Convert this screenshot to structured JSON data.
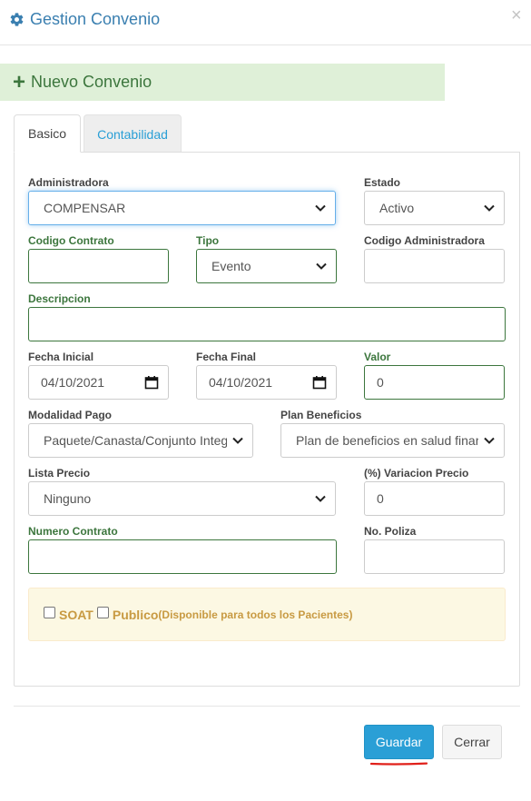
{
  "header": {
    "title": "Gestion Convenio",
    "icon": "gear-icon",
    "close_label": "×",
    "title_color": "#3a7fb0"
  },
  "banner": {
    "label": "Nuevo Convenio",
    "plus": "+",
    "bg_color": "#dff0d8",
    "text_color": "#3c763d"
  },
  "tabs": [
    {
      "label": "Basico",
      "active": true
    },
    {
      "label": "Contabilidad",
      "active": false
    }
  ],
  "form": {
    "administradora": {
      "label": "Administradora",
      "value": "COMPENSAR"
    },
    "estado": {
      "label": "Estado",
      "value": "Activo"
    },
    "codigo_contrato": {
      "label": "Codigo Contrato",
      "value": ""
    },
    "tipo": {
      "label": "Tipo",
      "value": "Evento"
    },
    "codigo_administradora": {
      "label": "Codigo Administradora",
      "value": ""
    },
    "descripcion": {
      "label": "Descripcion",
      "value": ""
    },
    "fecha_inicial": {
      "label": "Fecha Inicial",
      "value": "04/10/2021"
    },
    "fecha_final": {
      "label": "Fecha Final",
      "value": "04/10/2021"
    },
    "valor": {
      "label": "Valor",
      "value": "0"
    },
    "modalidad_pago": {
      "label": "Modalidad Pago",
      "value": "Paquete/Canasta/Conjunto Integ"
    },
    "plan_beneficios": {
      "label": "Plan Beneficios",
      "value": "Plan de beneficios en salud finar"
    },
    "lista_precio": {
      "label": "Lista Precio",
      "value": "Ninguno"
    },
    "variacion_precio": {
      "label": "(%) Variacion Precio",
      "value": "0"
    },
    "numero_contrato": {
      "label": "Numero Contrato",
      "value": ""
    },
    "no_poliza": {
      "label": "No. Poliza",
      "value": ""
    }
  },
  "options": {
    "soat_label": "SOAT",
    "publico_label": "Publico",
    "publico_note": "(Disponible para todos los Pacientes)",
    "soat_checked": false,
    "publico_checked": false
  },
  "footer": {
    "save_label": "Guardar",
    "close_label": "Cerrar",
    "accent_color": "#2a9fd6"
  }
}
